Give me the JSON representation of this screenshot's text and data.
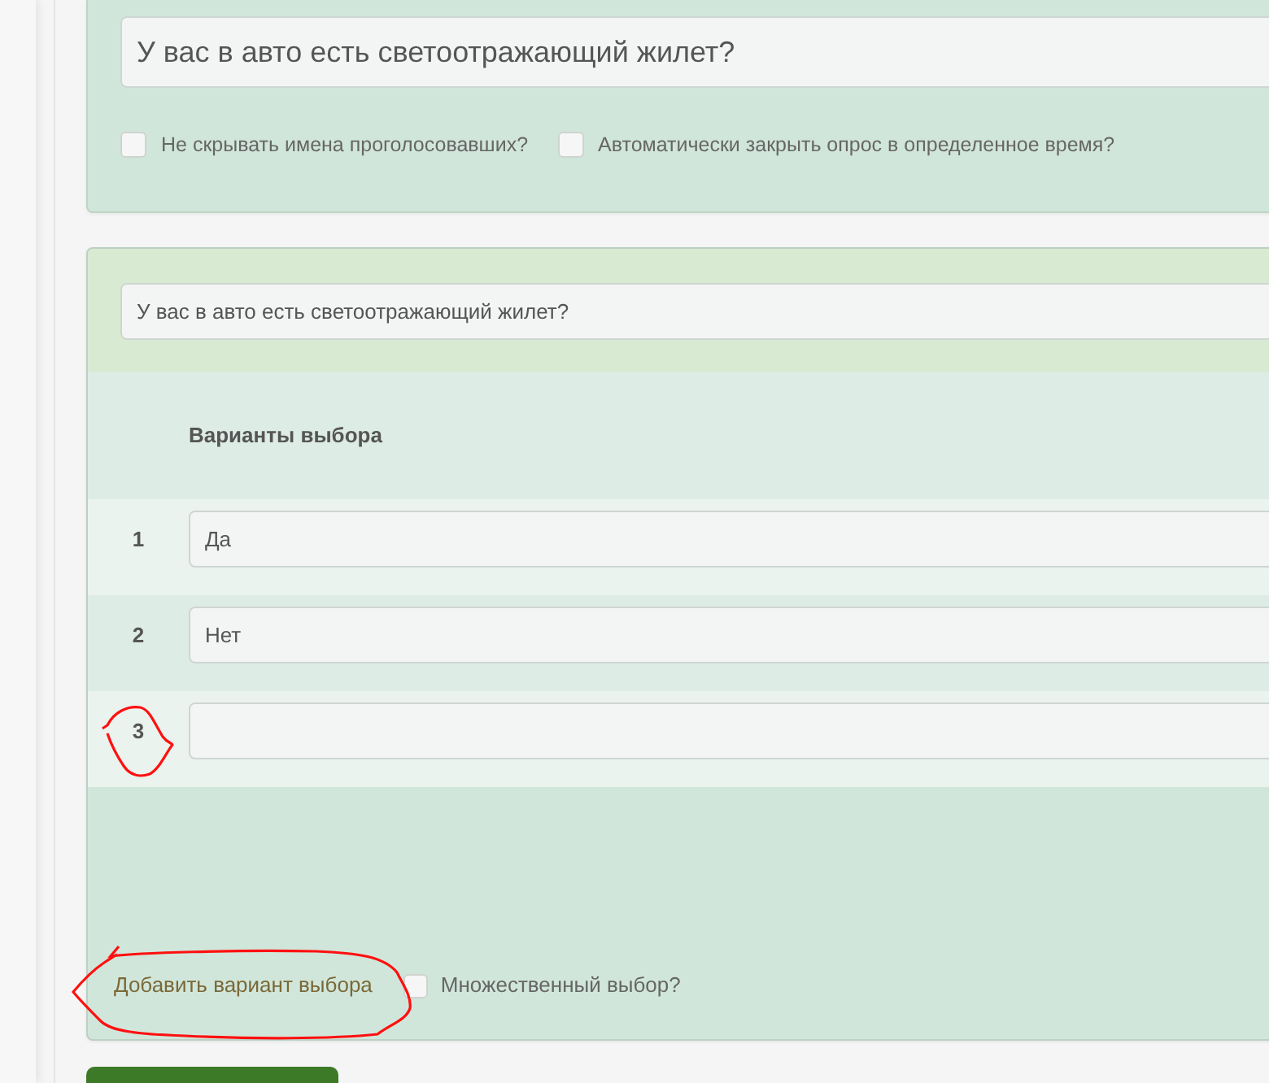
{
  "poll_card": {
    "question": {
      "value": "У вас в авто есть светоотражающий жилет?"
    },
    "options": [
      {
        "label": "Не скрывать имена проголосовавших?",
        "checked": false
      },
      {
        "label": "Автоматически закрыть опрос в определенное время?",
        "checked": false
      }
    ]
  },
  "question_card": {
    "question": {
      "value": "У вас в авто есть светоотражающий жилет?"
    },
    "choices_heading": "Варианты выбора",
    "choices": [
      {
        "number": "1",
        "value": "Да"
      },
      {
        "number": "2",
        "value": "Нет"
      },
      {
        "number": "3"
      }
    ],
    "add_choice_button": "Добавить вариант выбора",
    "multiple_choice": {
      "label": "Множественный выбор?",
      "checked": false
    }
  }
}
